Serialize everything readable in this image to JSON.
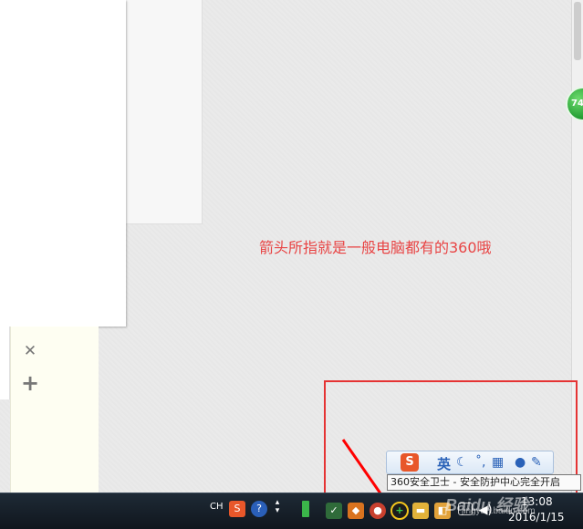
{
  "left_panel": {
    "close_symbol": "✕",
    "add_symbol": "+"
  },
  "float_ball": {
    "value": "74"
  },
  "caption": "箭头所指就是一般电脑都有的360哦",
  "ime_toolbar": {
    "logo": "S",
    "mode": "英",
    "icons": [
      "moon-icon",
      "punctuation-icon",
      "keyboard-icon",
      "user-icon",
      "wrench-icon"
    ]
  },
  "tooltip": "360安全卫士 - 安全防护中心完全开启",
  "taskbar": {
    "language": "CH",
    "time": "13:08",
    "date": "2016/1/15"
  },
  "watermark": {
    "brand": "Baidu 经验",
    "url": "jingyan.baidu.com"
  },
  "colors": {
    "caption": "#e84444",
    "highlight": "#e53333",
    "taskbar": "#1a232c"
  }
}
